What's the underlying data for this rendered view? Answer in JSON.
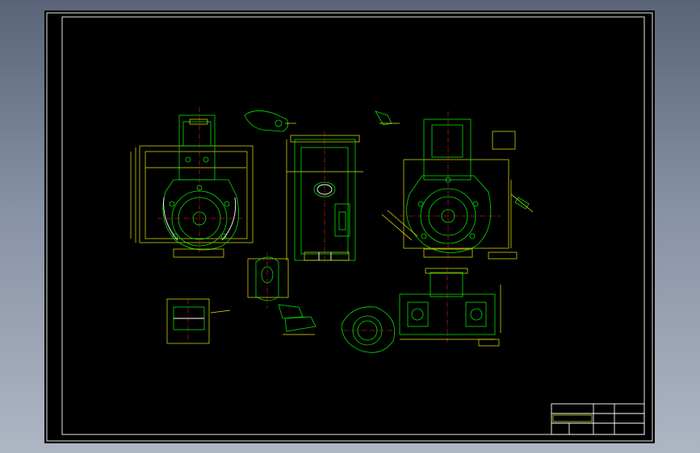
{
  "sheet": {
    "background": "#000000",
    "frame_color": "#ffffff",
    "geometry_color": "#00e000",
    "dimension_color": "#e8e800",
    "centerline_color": "#ff3030"
  },
  "views": [
    {
      "id": "front-view",
      "name": "housing-front-view"
    },
    {
      "id": "section-view-top",
      "name": "section-view-top"
    },
    {
      "id": "side-view",
      "name": "housing-side-view"
    },
    {
      "id": "rear-view",
      "name": "housing-rear-view"
    },
    {
      "id": "section-bottom",
      "name": "housing-bottom-section"
    },
    {
      "id": "detail-boss",
      "name": "detail-boss"
    },
    {
      "id": "detail-small",
      "name": "detail-small"
    },
    {
      "id": "detail-left",
      "name": "detail-left"
    },
    {
      "id": "detail-round",
      "name": "detail-round"
    }
  ],
  "title_block": {
    "position": "bottom-right"
  }
}
